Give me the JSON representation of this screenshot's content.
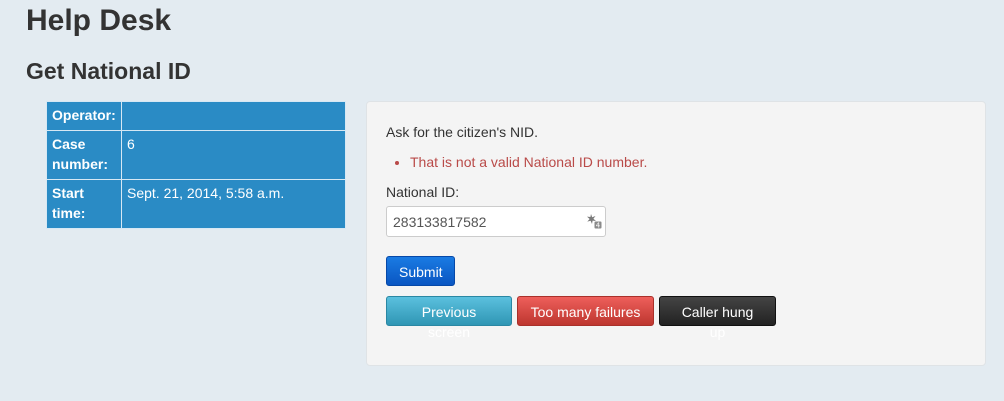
{
  "header": {
    "title": "Help Desk",
    "subtitle": "Get National ID"
  },
  "info": {
    "rows": [
      {
        "label": "Operator:",
        "value": ""
      },
      {
        "label": "Case number:",
        "value": "6"
      },
      {
        "label": "Start time:",
        "value": "Sept. 21, 2014, 5:58 a.m."
      }
    ]
  },
  "form": {
    "instruction": "Ask for the citizen's NID.",
    "errors": [
      "That is not a valid National ID number."
    ],
    "field_label": "National ID:",
    "field_value": "283133817582",
    "autofill_icon": "password-manager-key-icon",
    "submit_label": "Submit"
  },
  "actions": {
    "previous_label": "Previous screen",
    "failures_label": "Too many failures",
    "hung_up_label": "Caller hung up"
  },
  "colors": {
    "background": "#e3ebf1",
    "info_table": "#2a8bc5",
    "error": "#b94a48",
    "submit": "#0a56c2",
    "info_button": "#5bc0de",
    "danger_button": "#da4f49",
    "inverse_button": "#222222"
  }
}
